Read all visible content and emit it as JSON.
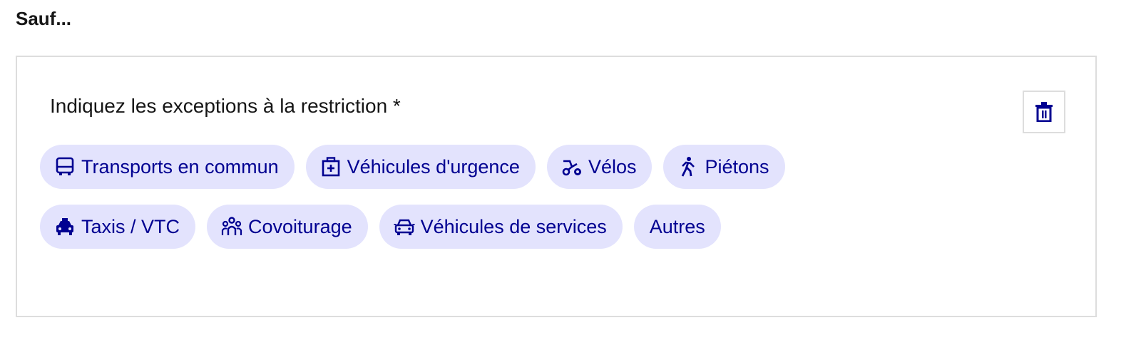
{
  "heading": "Sauf...",
  "field": {
    "label": "Indiquez les exceptions à la restriction *"
  },
  "delete_icon": "trash-icon",
  "tags_row1": [
    {
      "label": "Transports en commun",
      "icon": "bus-icon"
    },
    {
      "label": "Véhicules d'urgence",
      "icon": "first-aid-kit-icon"
    },
    {
      "label": "Vélos",
      "icon": "bike-icon"
    },
    {
      "label": "Piétons",
      "icon": "pedestrian-icon"
    }
  ],
  "tags_row2": [
    {
      "label": "Taxis / VTC",
      "icon": "taxi-icon"
    },
    {
      "label": "Covoiturage",
      "icon": "group-icon"
    },
    {
      "label": "Véhicules de services",
      "icon": "car-icon"
    },
    {
      "label": "Autres",
      "icon": ""
    }
  ],
  "colors": {
    "tag_background": "#e3e3fd",
    "tag_text": "#000091",
    "border": "#dddddd"
  }
}
